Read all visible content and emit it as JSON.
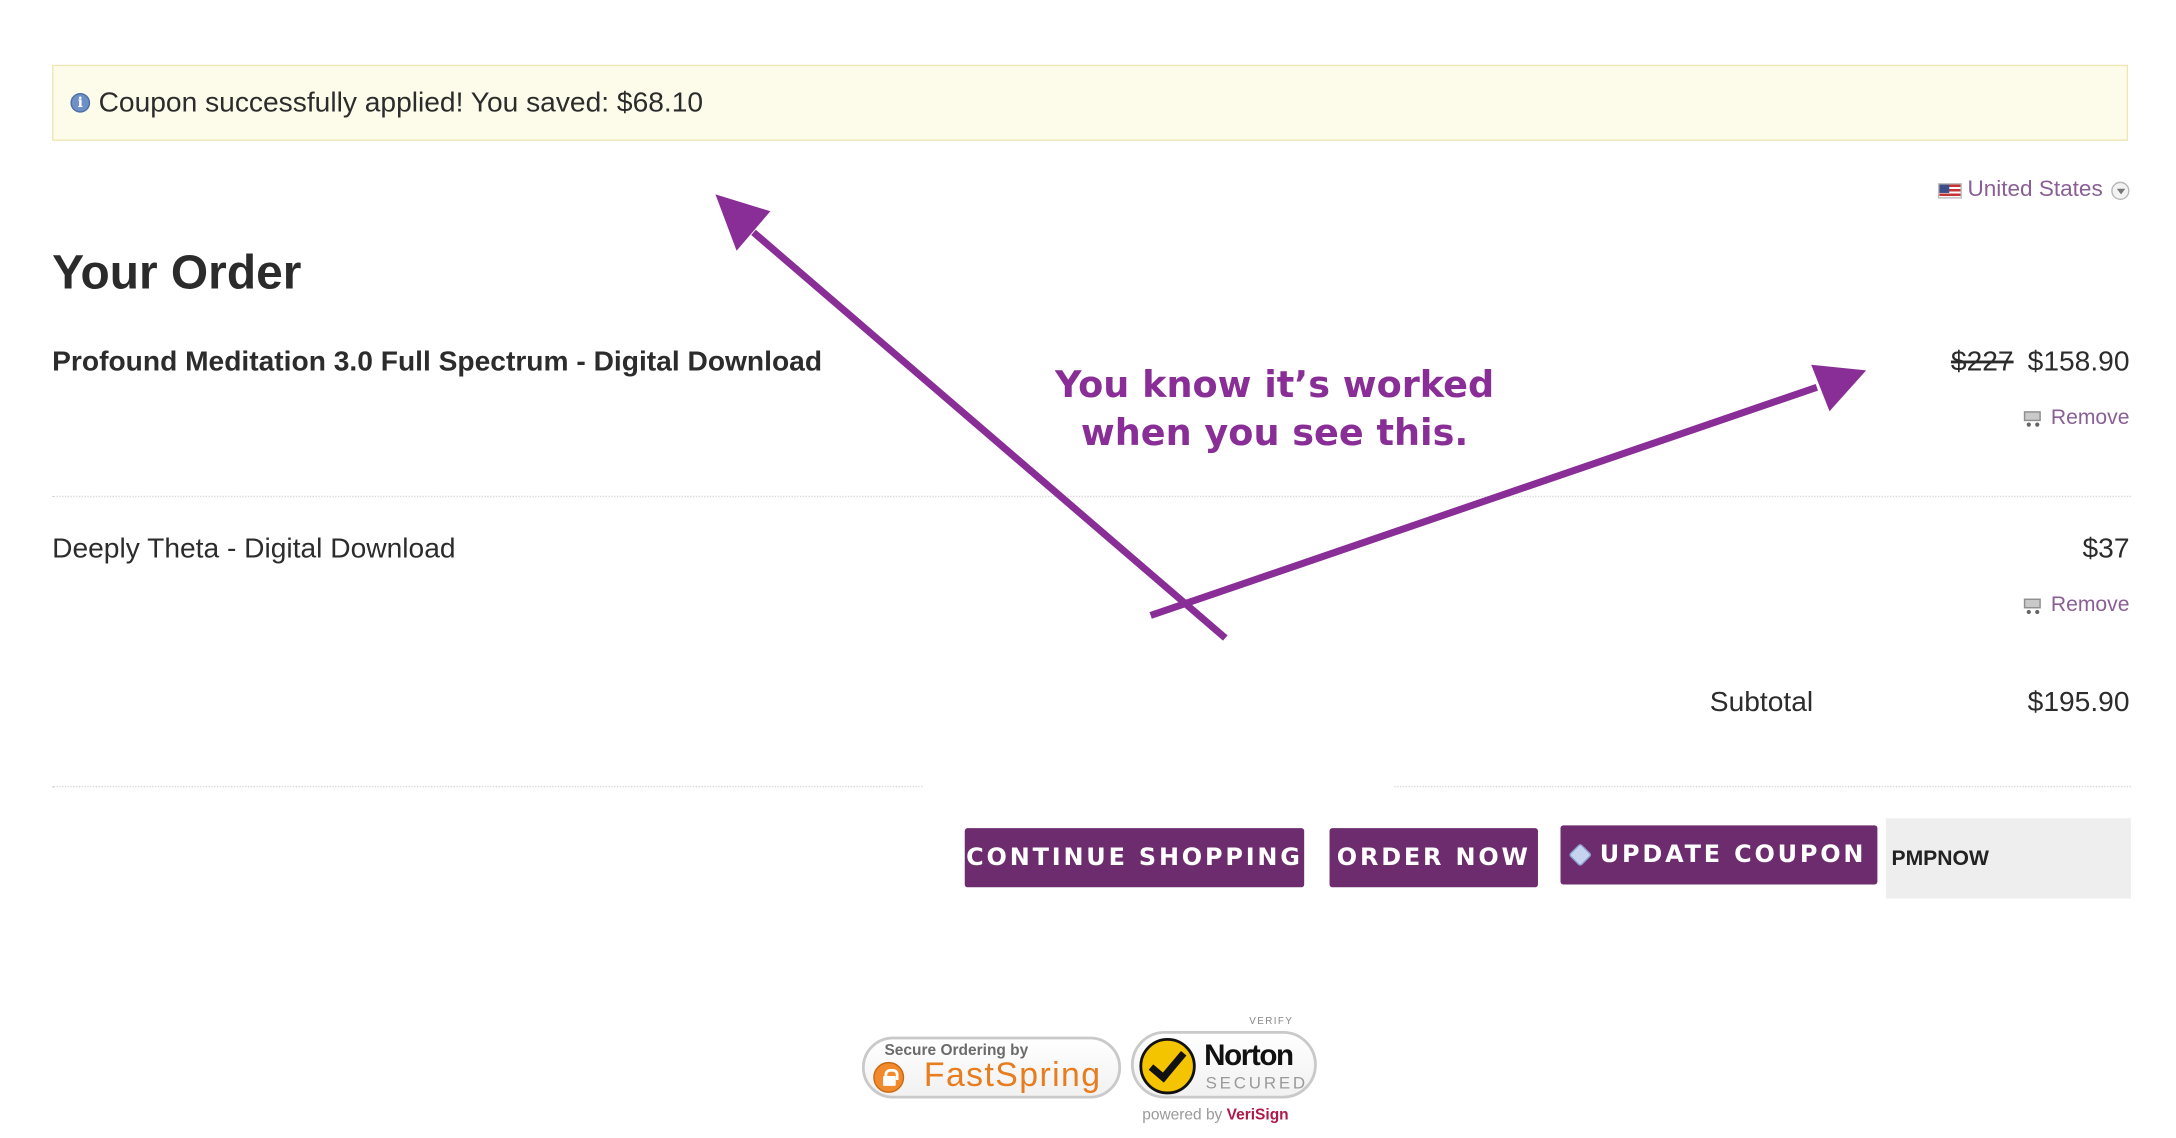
{
  "notice": {
    "text": "Coupon successfully applied! You saved: $68.10",
    "icon": "info-icon"
  },
  "locale": {
    "country": "United States"
  },
  "order": {
    "title": "Your Order",
    "items": [
      {
        "name": "Profound Meditation 3.0 Full Spectrum - Digital Download",
        "original_price": "$227",
        "price": "$158.90",
        "remove_label": "Remove"
      },
      {
        "name": "Deeply Theta - Digital Download",
        "price": "$37",
        "remove_label": "Remove"
      }
    ],
    "subtotal_label": "Subtotal",
    "subtotal_value": "$195.90"
  },
  "actions": {
    "continue_label": "CONTINUE SHOPPING",
    "order_label": "ORDER NOW",
    "coupon_label": "UPDATE COUPON",
    "coupon_value": "PMPNOW"
  },
  "badges": {
    "fastspring_small": "Secure Ordering by",
    "fastspring_big": "FastSpring",
    "norton_verify": "VERIFY",
    "norton_name": "Norton",
    "norton_secured": "SECURED",
    "powered_by": "powered by",
    "verisign": "VeriSign"
  },
  "annotation": {
    "line1": "You know it’s worked",
    "line2": "when you see this."
  },
  "colors": {
    "accent": "#6d2c6d",
    "link": "#8a5f95",
    "annotation": "#8a2e97",
    "notice_bg": "#fdfcea"
  }
}
